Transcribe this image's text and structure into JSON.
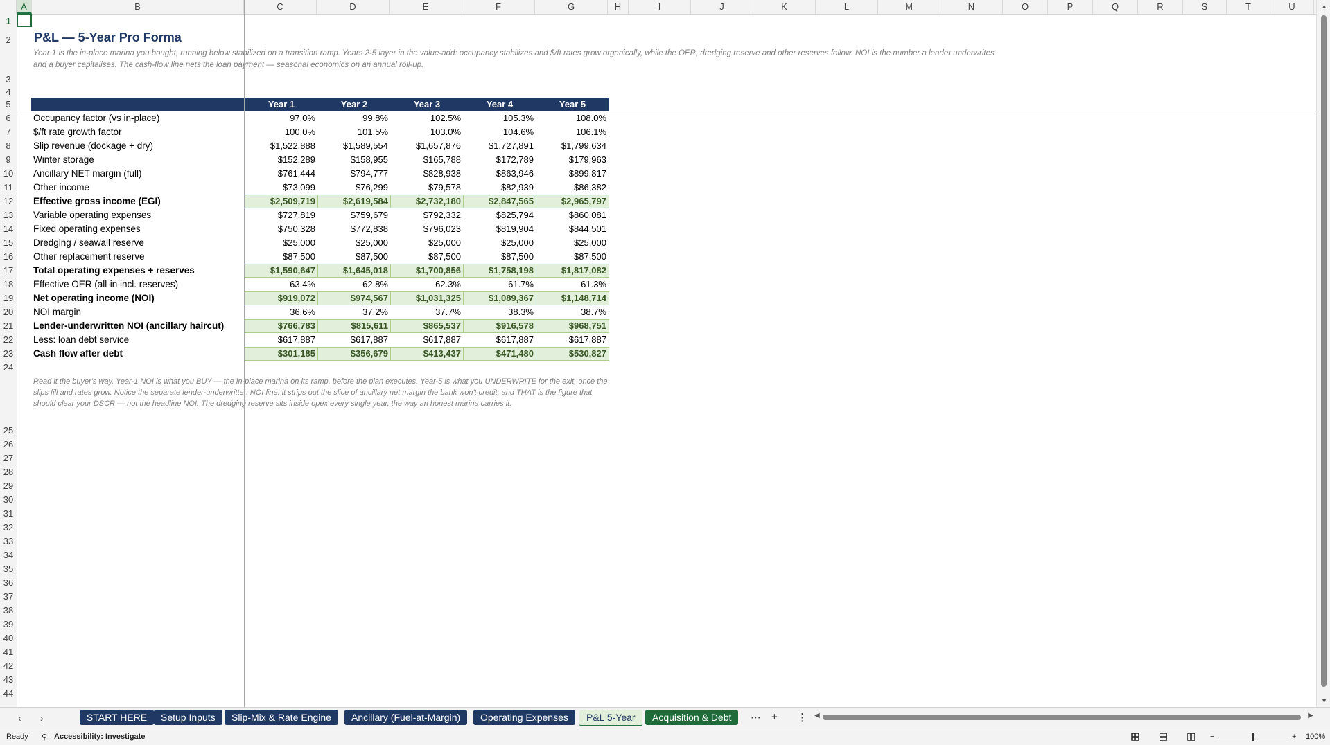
{
  "sheet": {
    "columns": [
      "A",
      "B",
      "C",
      "D",
      "E",
      "F",
      "G",
      "H",
      "I",
      "J",
      "K",
      "L",
      "M",
      "N",
      "O",
      "P",
      "Q",
      "R",
      "S",
      "T",
      "U"
    ],
    "row_numbers": [
      "1",
      "2",
      "3",
      "4",
      "5",
      "6",
      "7",
      "8",
      "9",
      "10",
      "11",
      "12",
      "13",
      "14",
      "15",
      "16",
      "17",
      "18",
      "19",
      "20",
      "21",
      "22",
      "23",
      "24",
      "25",
      "26",
      "27",
      "28",
      "29",
      "30",
      "31",
      "32",
      "33",
      "34",
      "35",
      "36",
      "37",
      "38",
      "39",
      "40",
      "41",
      "42",
      "43",
      "44"
    ],
    "title": "P&L — 5-Year Pro Forma",
    "subtitle": "Year 1 is the in-place marina you bought, running below stabilized on a transition ramp. Years 2-5 layer in the value-add: occupancy stabilizes and $/ft rates grow organically, while the OER, dredging reserve and other reserves follow. NOI is the number a lender underwrites and a buyer capitalises. The cash-flow line nets the loan payment — seasonal economics on an annual roll-up.",
    "year_headers": [
      "Year 1",
      "Year 2",
      "Year 3",
      "Year 4",
      "Year 5"
    ],
    "rows": [
      {
        "label": "Occupancy factor (vs in-place)",
        "values": [
          "97.0%",
          "99.8%",
          "102.5%",
          "105.3%",
          "108.0%"
        ],
        "bold": false
      },
      {
        "label": "$/ft rate growth factor",
        "values": [
          "100.0%",
          "101.5%",
          "103.0%",
          "104.6%",
          "106.1%"
        ],
        "bold": false
      },
      {
        "label": "Slip revenue (dockage + dry)",
        "values": [
          "$1,522,888",
          "$1,589,554",
          "$1,657,876",
          "$1,727,891",
          "$1,799,634"
        ],
        "bold": false
      },
      {
        "label": "Winter storage",
        "values": [
          "$152,289",
          "$158,955",
          "$165,788",
          "$172,789",
          "$179,963"
        ],
        "bold": false
      },
      {
        "label": "Ancillary NET margin (full)",
        "values": [
          "$761,444",
          "$794,777",
          "$828,938",
          "$863,946",
          "$899,817"
        ],
        "bold": false
      },
      {
        "label": "Other income",
        "values": [
          "$73,099",
          "$76,299",
          "$79,578",
          "$82,939",
          "$86,382"
        ],
        "bold": false
      },
      {
        "label": "Effective gross income (EGI)",
        "values": [
          "$2,509,719",
          "$2,619,584",
          "$2,732,180",
          "$2,847,565",
          "$2,965,797"
        ],
        "bold": true
      },
      {
        "label": "Variable operating expenses",
        "values": [
          "$727,819",
          "$759,679",
          "$792,332",
          "$825,794",
          "$860,081"
        ],
        "bold": false
      },
      {
        "label": "Fixed operating expenses",
        "values": [
          "$750,328",
          "$772,838",
          "$796,023",
          "$819,904",
          "$844,501"
        ],
        "bold": false
      },
      {
        "label": "Dredging / seawall reserve",
        "values": [
          "$25,000",
          "$25,000",
          "$25,000",
          "$25,000",
          "$25,000"
        ],
        "bold": false
      },
      {
        "label": "Other replacement reserve",
        "values": [
          "$87,500",
          "$87,500",
          "$87,500",
          "$87,500",
          "$87,500"
        ],
        "bold": false
      },
      {
        "label": "Total operating expenses + reserves",
        "values": [
          "$1,590,647",
          "$1,645,018",
          "$1,700,856",
          "$1,758,198",
          "$1,817,082"
        ],
        "bold": true
      },
      {
        "label": "Effective OER (all-in incl. reserves)",
        "values": [
          "63.4%",
          "62.8%",
          "62.3%",
          "61.7%",
          "61.3%"
        ],
        "bold": false
      },
      {
        "label": "Net operating income (NOI)",
        "values": [
          "$919,072",
          "$974,567",
          "$1,031,325",
          "$1,089,367",
          "$1,148,714"
        ],
        "bold": true
      },
      {
        "label": "NOI margin",
        "values": [
          "36.6%",
          "37.2%",
          "37.7%",
          "38.3%",
          "38.7%"
        ],
        "bold": false
      },
      {
        "label": "Lender-underwritten NOI (ancillary haircut)",
        "values": [
          "$766,783",
          "$815,611",
          "$865,537",
          "$916,578",
          "$968,751"
        ],
        "bold": true
      },
      {
        "label": "Less: loan debt service",
        "values": [
          "$617,887",
          "$617,887",
          "$617,887",
          "$617,887",
          "$617,887"
        ],
        "bold": false
      },
      {
        "label": "Cash flow after debt",
        "values": [
          "$301,185",
          "$356,679",
          "$413,437",
          "$471,480",
          "$530,827"
        ],
        "bold": true
      }
    ],
    "note": "Read it the buyer's way. Year-1 NOI is what you BUY — the in-place marina on its ramp, before the plan executes. Year-5 is what you UNDERWRITE for the exit, once the slips fill and rates grow. Notice the separate lender-underwritten NOI line: it strips out the slice of ancillary net margin the bank won't credit, and THAT is the figure that should clear your DSCR — not the headline NOI. The dredging reserve sits inside opex every single year, the way an honest marina carries it."
  },
  "tabs": [
    {
      "label": "START HERE",
      "state": "normal"
    },
    {
      "label": "Setup Inputs",
      "state": "normal"
    },
    {
      "label": "Slip-Mix & Rate Engine",
      "state": "normal"
    },
    {
      "label": "Ancillary (Fuel-at-Margin)",
      "state": "normal"
    },
    {
      "label": "Operating Expenses",
      "state": "normal"
    },
    {
      "label": "P&L 5-Year",
      "state": "active"
    },
    {
      "label": "Acquisition & Debt",
      "state": "green"
    }
  ],
  "status": {
    "ready": "Ready",
    "accessibility": "Accessibility: Investigate",
    "zoom": "100%"
  },
  "colors": {
    "header_navy": "#1f3864",
    "highlight_green": "#e2efda",
    "tab_green": "#1f6b3a"
  }
}
